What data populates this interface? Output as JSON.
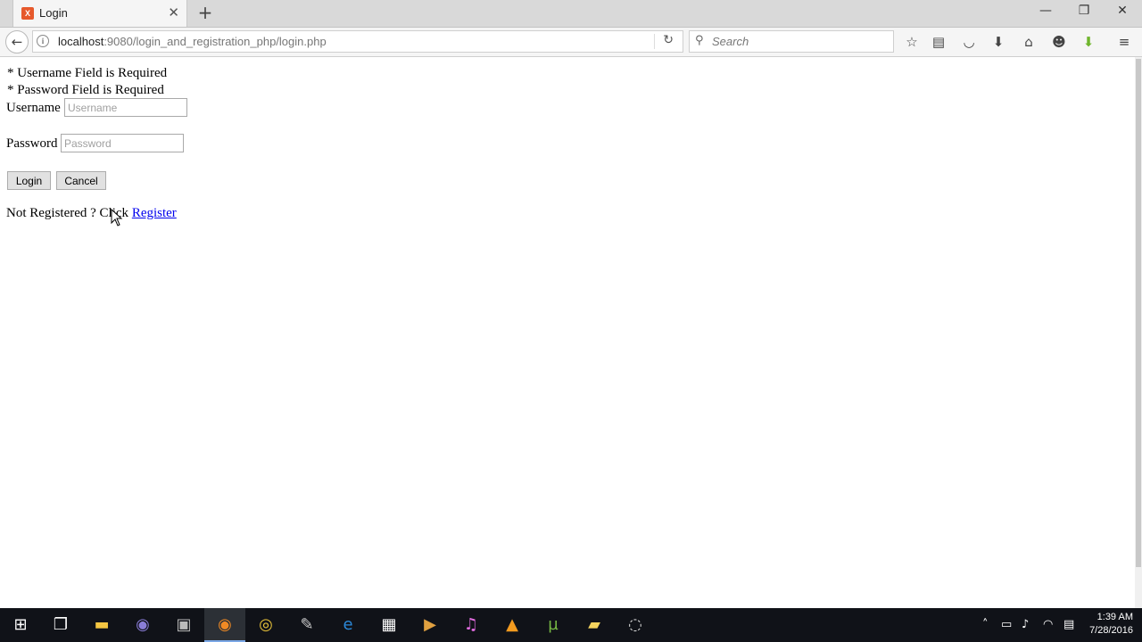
{
  "browser": {
    "tab": {
      "title": "Login",
      "favicon": "xampp-icon"
    },
    "url": {
      "host": "localhost",
      "path": ":9080/login_and_registration_php/login.php"
    },
    "search_placeholder": "Search"
  },
  "page": {
    "errors": [
      "* Username Field is Required",
      "* Password Field is Required"
    ],
    "username_label": "Username",
    "username_placeholder": "Username",
    "username_value": "",
    "password_label": "Password",
    "password_placeholder": "Password",
    "password_value": "",
    "login_button": "Login",
    "cancel_button": "Cancel",
    "register_prompt": "Not Registered ? Click ",
    "register_link": "Register"
  },
  "taskbar": {
    "clock_time": "1:39 AM",
    "clock_date": "7/28/2016",
    "apps": [
      "start-icon",
      "task-view-icon",
      "file-explorer-icon",
      "eclipse-icon",
      "sublime-icon",
      "firefox-icon",
      "chrome-icon",
      "app-icon",
      "edge-icon",
      "store-icon",
      "media-icon",
      "itunes-icon",
      "vlc-icon",
      "utorrent-icon",
      "folder-icon",
      "obs-icon"
    ]
  }
}
